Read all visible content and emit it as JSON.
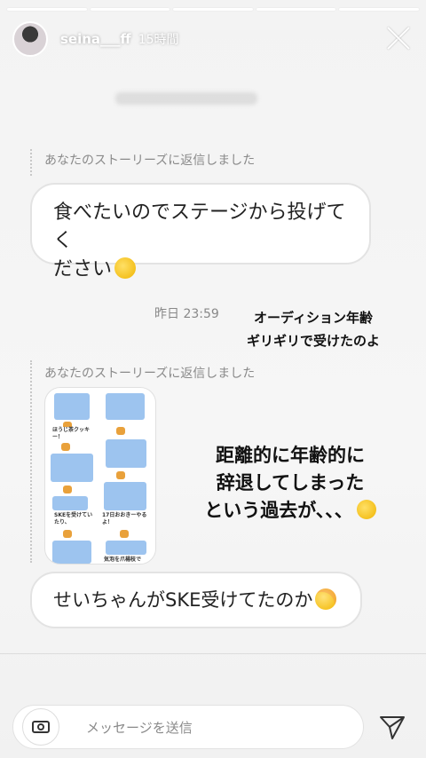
{
  "header": {
    "username": "seina___ff",
    "time_ago": "15時間",
    "avatar_icon": "avatar",
    "close_icon": "close-icon"
  },
  "progress_segments": 5,
  "messages": {
    "reply_label_1": "あなたのストーリーズに返信しました",
    "bubble_1_line_1": "食べたいのでステージから投げてく",
    "bubble_1_line_2": "ださい",
    "timestamp": "昨日 23:59",
    "reply_label_2": "あなたのストーリーズに返信しました",
    "bubble_2": "せいちゃんがSKE受けてたのか"
  },
  "overlay": {
    "text_1_line_1": "オーディション年齢",
    "text_1_line_2": "ギリギリで受けたのよ",
    "text_2_line_1": "距離的に年齢的に",
    "text_2_line_2": "辞退してしまった",
    "text_2_line_3": "という過去が、、、"
  },
  "story_image_captions": [
    "ほうじ茶クッキー！",
    "SKEを受けていたり、",
    "17日おおきーやるよ！",
    "気泡を爪楊枝で"
  ],
  "composer": {
    "placeholder": "メッセージを送信"
  },
  "colors": {
    "tile_blue": "#9dc4ef",
    "text_gray": "#8a8a8a"
  }
}
